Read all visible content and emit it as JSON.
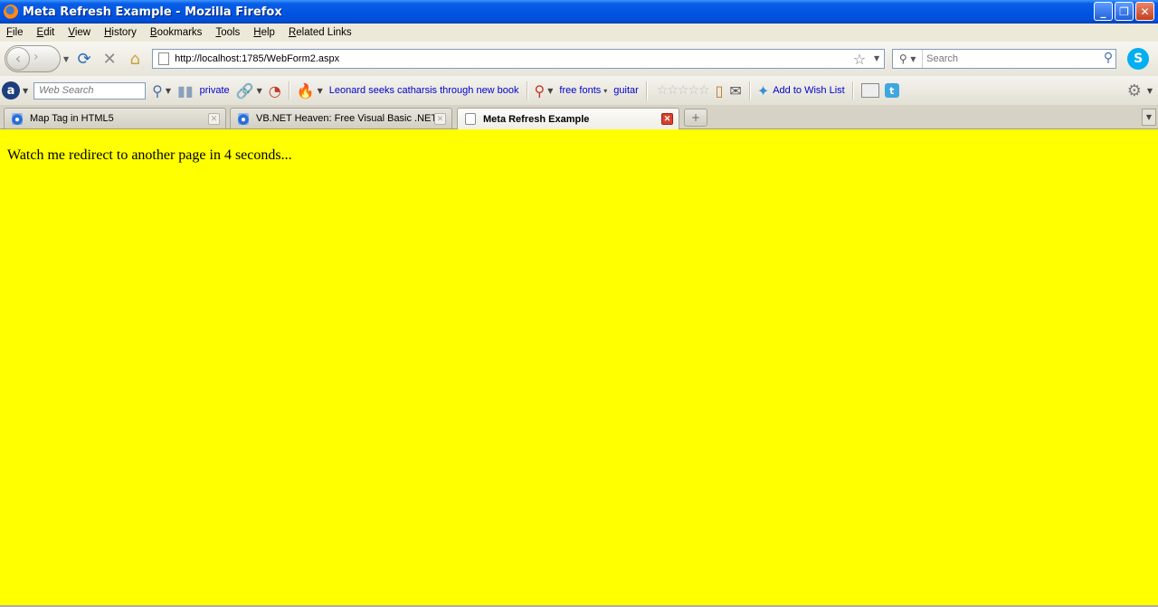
{
  "window": {
    "title": "Meta Refresh Example - Mozilla Firefox",
    "minimize": "_",
    "restore": "❐",
    "close": "✕"
  },
  "menu": [
    "File",
    "Edit",
    "View",
    "History",
    "Bookmarks",
    "Tools",
    "Help",
    "Related Links"
  ],
  "nav": {
    "url": "http://localhost:1785/WebForm2.aspx",
    "search_placeholder": "Search",
    "skype_label": "S"
  },
  "addon_toolbar": {
    "search_placeholder": "Web Search",
    "private_label": "private",
    "headline_link": "Leonard seeks catharsis through new book",
    "free_fonts_label": "free fonts",
    "guitar_label": "guitar",
    "wishlist_label": "Add to Wish List",
    "rating_stars": "☆☆☆☆☆"
  },
  "tabs": [
    {
      "title": "Map Tag in HTML5",
      "active": false
    },
    {
      "title": "VB.NET Heaven: Free Visual Basic .NET...",
      "active": false
    },
    {
      "title": "Meta Refresh Example",
      "active": true
    }
  ],
  "content": {
    "background": "#ffff00",
    "text": "Watch me redirect to another page in 4 seconds..."
  }
}
